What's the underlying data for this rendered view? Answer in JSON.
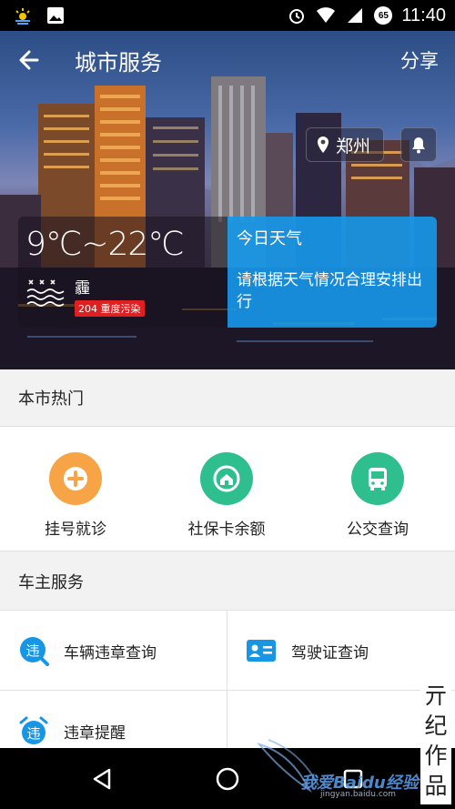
{
  "status_bar": {
    "time": "11:40",
    "battery_level": "65"
  },
  "header": {
    "title": "城市服务",
    "share_label": "分享"
  },
  "location": {
    "city": "郑州"
  },
  "weather": {
    "temperature": "9℃~22℃",
    "condition": "霾",
    "aqi_label": "204 重度污染",
    "panel_title": "今日天气",
    "panel_desc": "请根据天气情况合理安排出行"
  },
  "hot_section": {
    "title": "本市热门",
    "items": [
      {
        "label": "挂号就诊",
        "icon": "plus-icon",
        "color": "#f7a447"
      },
      {
        "label": "社保卡余额",
        "icon": "home-icon",
        "color": "#2fbf8f"
      },
      {
        "label": "公交查询",
        "icon": "bus-icon",
        "color": "#2fbf8f"
      }
    ]
  },
  "car_section": {
    "title": "车主服务",
    "items": [
      {
        "label": "车辆违章查询",
        "icon": "violation-search-icon"
      },
      {
        "label": "驾驶证查询",
        "icon": "license-card-icon"
      },
      {
        "label": "违章提醒",
        "icon": "alarm-clock-icon"
      }
    ]
  },
  "watermark": {
    "vertical_text": "亓纪作品",
    "baidu_text": "我爱Baidu经验",
    "url": "jingyan.baidu.com"
  },
  "colors": {
    "accent_blue": "#1796e6",
    "aqi_red": "#e02020",
    "orange": "#f7a447",
    "green": "#2fbf8f"
  }
}
